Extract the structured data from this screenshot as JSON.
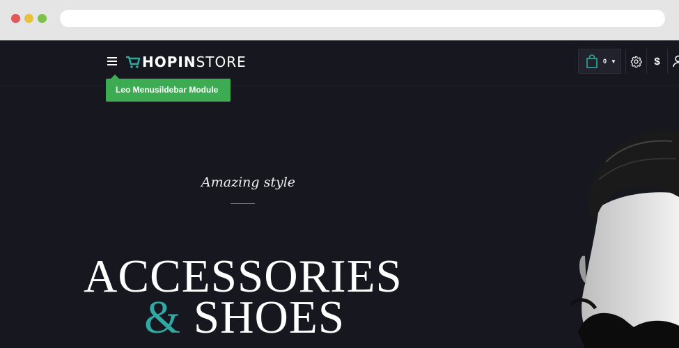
{
  "browser": {
    "url": ""
  },
  "header": {
    "logo_part1": "HOPIN",
    "logo_part2": "STORE",
    "cart_count": "0",
    "currency_symbol": "$"
  },
  "tooltip": {
    "label": "Leo Menusildebar Module"
  },
  "hero": {
    "subtitle": "Amazing style",
    "title_line1": "ACCESSORIES",
    "title_amp": "&",
    "title_line2": "SHOES"
  },
  "colors": {
    "accent": "#2fa9a2",
    "tooltip_bg": "#3cab52",
    "page_bg": "#16171f"
  }
}
